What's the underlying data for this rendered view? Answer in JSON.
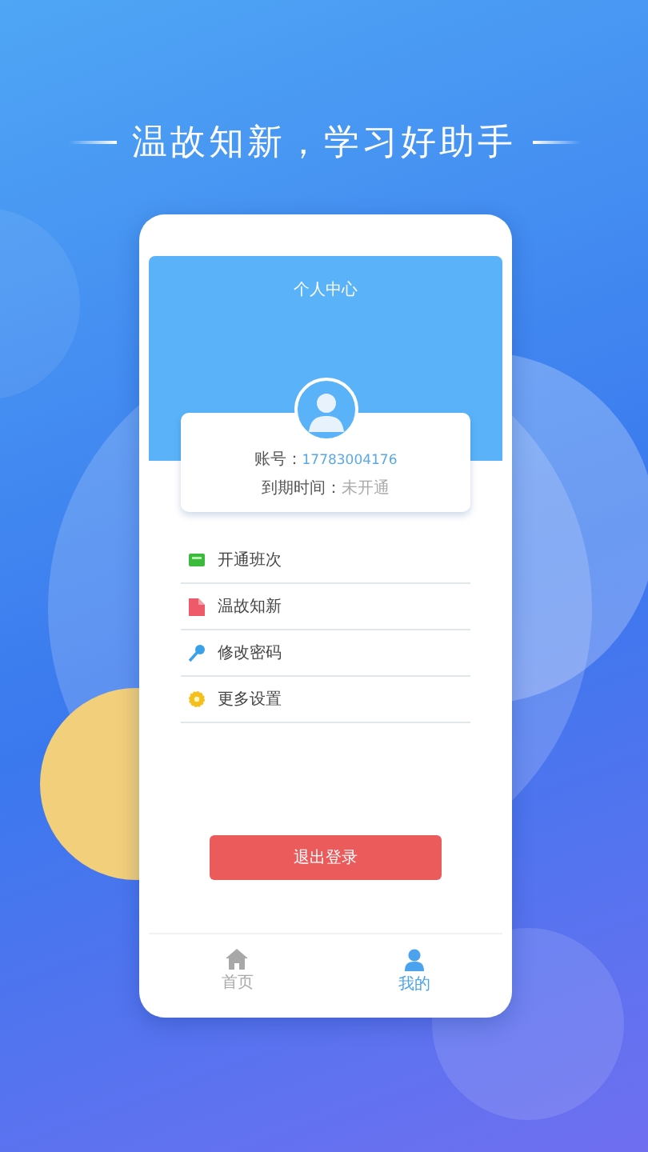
{
  "headline": "温故知新，学习好助手",
  "header": {
    "title": "个人中心"
  },
  "account": {
    "label": "账号：",
    "value": "17783004176"
  },
  "expiry": {
    "label": "到期时间：",
    "value": "未开通"
  },
  "menu": [
    {
      "kind": "class",
      "label": "开通班次"
    },
    {
      "kind": "review",
      "label": "温故知新"
    },
    {
      "kind": "password",
      "label": "修改密码"
    },
    {
      "kind": "settings",
      "label": "更多设置"
    }
  ],
  "logout": "退出登录",
  "tabs": [
    {
      "kind": "home",
      "label": "首页",
      "selected": false
    },
    {
      "kind": "user",
      "label": "我的",
      "selected": true
    }
  ]
}
